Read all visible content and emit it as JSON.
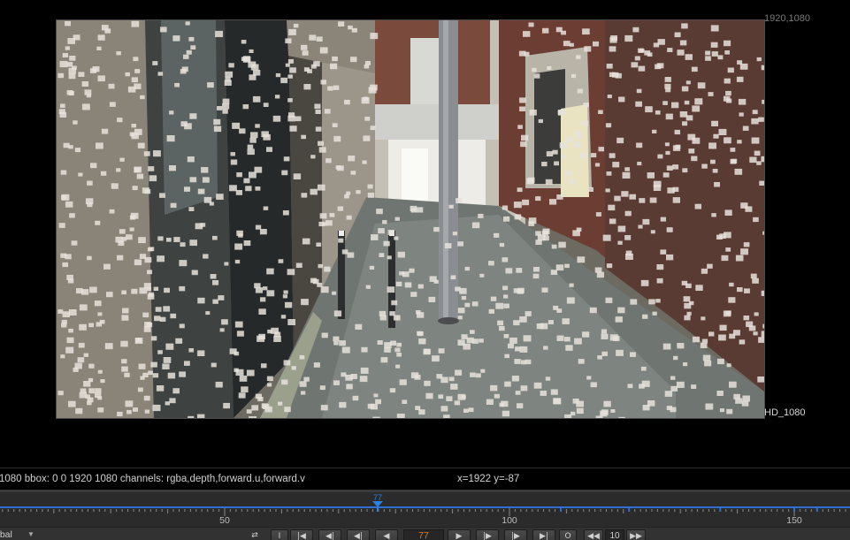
{
  "viewer": {
    "resolution_label": "1920,1080",
    "format_label": "HD_1080",
    "image_description_icon": "viewer-image"
  },
  "info_bar": {
    "main_text": "1080  bbox: 0 0 1920 1080 channels: rgba,depth,forward.u,forward.v",
    "coords_text": "x=1922 y=-87"
  },
  "timeline": {
    "current_frame": "77",
    "tick_labels": [
      "50",
      "100",
      "150"
    ],
    "colors": {
      "ruler_blue": "#2f6fcf",
      "playhead": "#2a80e0",
      "current_frame_text": "#e07b1f"
    }
  },
  "transport": {
    "mode_label": "obal",
    "frame_value": "77",
    "step_value": "10",
    "buttons": {
      "sync": "⇄",
      "in": "I",
      "first": "|◀",
      "prev_key": "◀|",
      "prev_frame": "◀|",
      "play_back": "◀",
      "play_fwd": "▶",
      "next_frame": "|▶",
      "next_key": "|▶",
      "last": "▶|",
      "out": "O",
      "skip_back": "◀◀",
      "skip_fwd": "▶▶"
    }
  }
}
